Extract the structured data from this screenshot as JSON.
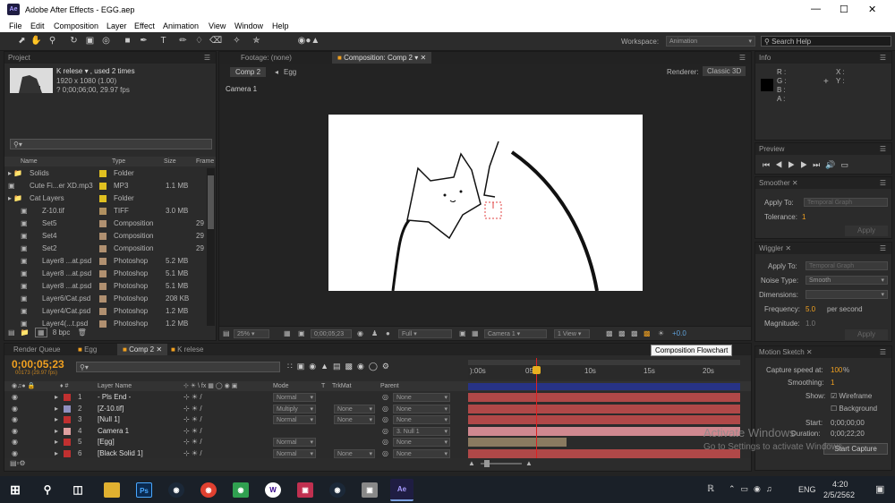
{
  "window": {
    "title": "Adobe After Effects - EGG.aep",
    "app_icon": "Ae"
  },
  "menu": [
    "File",
    "Edit",
    "Composition",
    "Layer",
    "Effect",
    "Animation",
    "View",
    "Window",
    "Help"
  ],
  "toolbar": {
    "workspace_label": "Workspace:",
    "workspace_value": "Animation",
    "search_placeholder": "Search Help"
  },
  "project": {
    "tab": "Project",
    "item_name": "K relese ▾ , used 2 times",
    "item_size": "1920 x 1080 (1.00)",
    "item_duration": "? 0;00;06;00, 29.97 fps",
    "columns": [
      "Name",
      "Type",
      "Size",
      "Frame"
    ],
    "items": [
      {
        "name": "Solids",
        "type": "Folder",
        "size": "",
        "frame": "",
        "color": "#e0c020",
        "icon": "folder-icon"
      },
      {
        "name": "Cute Fi...er XD.mp3",
        "type": "MP3",
        "size": "1.1 MB",
        "frame": "",
        "color": "#e0c020",
        "icon": "audio-icon"
      },
      {
        "name": "Cat Layers",
        "type": "Folder",
        "size": "",
        "frame": "",
        "color": "#e0c020",
        "icon": "folder-icon"
      },
      {
        "name": "Z-10.tif",
        "type": "TIFF",
        "size": "3.0 MB",
        "frame": "",
        "color": "#b09060",
        "icon": "image-icon"
      },
      {
        "name": "Set5",
        "type": "Composition",
        "size": "",
        "frame": "29",
        "color": "#b09070",
        "icon": "composition-icon"
      },
      {
        "name": "Set4",
        "type": "Composition",
        "size": "",
        "frame": "29",
        "color": "#b09070",
        "icon": "composition-icon"
      },
      {
        "name": "Set2",
        "type": "Composition",
        "size": "",
        "frame": "29",
        "color": "#b09070",
        "icon": "composition-icon"
      },
      {
        "name": "Layer8 ...at.psd",
        "type": "Photoshop",
        "size": "5.2 MB",
        "frame": "",
        "color": "#b09070",
        "icon": "psd-icon"
      },
      {
        "name": "Layer8 ...at.psd",
        "type": "Photoshop",
        "size": "5.1 MB",
        "frame": "",
        "color": "#b09070",
        "icon": "psd-icon"
      },
      {
        "name": "Layer8 ...at.psd",
        "type": "Photoshop",
        "size": "5.1 MB",
        "frame": "",
        "color": "#b09070",
        "icon": "psd-icon"
      },
      {
        "name": "Layer6/Cat.psd",
        "type": "Photoshop",
        "size": "208 KB",
        "frame": "",
        "color": "#b09070",
        "icon": "psd-icon"
      },
      {
        "name": "Layer4/Cat.psd",
        "type": "Photoshop",
        "size": "1.2 MB",
        "frame": "",
        "color": "#b09070",
        "icon": "psd-icon"
      },
      {
        "name": "Layer4(...t.psd",
        "type": "Photoshop",
        "size": "1.2 MB",
        "frame": "",
        "color": "#b09070",
        "icon": "psd-icon"
      }
    ],
    "bpc": "8 bpc"
  },
  "viewer": {
    "footage_tab": "Footage: (none)",
    "comp_tab": "Composition: Comp 2",
    "crumb1": "Comp 2",
    "crumb2": "Egg",
    "renderer_label": "Renderer:",
    "renderer_value": "Classic 3D",
    "camera_label": "Camera 1",
    "zoom": "25%",
    "timecode": "0;00;05;23",
    "quality": "Full",
    "camera": "Camera 1",
    "views": "1 View",
    "exposure": "+0.0"
  },
  "info": {
    "tab": "Info",
    "r": "R :",
    "g": "G :",
    "b": "B :",
    "a": "A :",
    "x": "X :",
    "y": "Y :"
  },
  "preview": {
    "tab": "Preview"
  },
  "smoother": {
    "tab": "Smoother",
    "apply_to_label": "Apply To:",
    "apply_to_value": "Temporal Graph",
    "tolerance_label": "Tolerance:",
    "tolerance_value": "1",
    "apply": "Apply"
  },
  "wiggler": {
    "tab": "Wiggler",
    "apply_to_label": "Apply To:",
    "apply_to_value": "Temporal Graph",
    "noise_label": "Noise Type:",
    "noise_value": "Smooth",
    "dims_label": "Dimensions:",
    "freq_label": "Frequency:",
    "freq_value": "5.0",
    "freq_unit": "per second",
    "mag_label": "Magnitude:",
    "mag_value": "1.0",
    "apply": "Apply"
  },
  "motion_sketch": {
    "tab": "Motion Sketch",
    "capture_label": "Capture speed at:",
    "capture_value": "100",
    "capture_unit": "%",
    "smoothing_label": "Smoothing:",
    "smoothing_value": "1",
    "show_label": "Show:",
    "wireframe": "Wireframe",
    "background": "Background",
    "start_label": "Start:",
    "start_value": "0;00;00;00",
    "duration_label": "Duration:",
    "duration_value": "0;00;22;20",
    "start_capture": "Start Capture"
  },
  "timeline": {
    "tabs": [
      "Render Queue",
      "Egg",
      "Comp 2",
      "K relese"
    ],
    "timecode": "0;00;05;23",
    "frames": "00173 (29.97 fps)",
    "tooltip": "Composition Flowchart",
    "col_layer": "Layer Name",
    "col_mode": "Mode",
    "col_t": "T",
    "col_trkmat": "TrkMat",
    "col_parent": "Parent",
    "ruler": [
      "):00s",
      "05s",
      "10s",
      "15s",
      "20s"
    ],
    "layers": [
      {
        "num": "1",
        "name": "- Pls End -",
        "color": "#c03030",
        "mode": "Normal",
        "trkmat": "",
        "parent": "None",
        "bar": "#b04848"
      },
      {
        "num": "2",
        "name": "[Z-10.tif]",
        "color": "#9090c0",
        "mode": "Multiply",
        "trkmat": "None",
        "parent": "None",
        "bar": "#b04848"
      },
      {
        "num": "3",
        "name": "[Null 1]",
        "color": "#c03030",
        "mode": "Normal",
        "trkmat": "None",
        "parent": "None",
        "bar": "#b04848"
      },
      {
        "num": "4",
        "name": "Camera 1",
        "color": "#e0a0a0",
        "mode": "",
        "trkmat": "",
        "parent": "3. Null 1",
        "bar": "#d08890"
      },
      {
        "num": "5",
        "name": "[Egg]",
        "color": "#c03030",
        "mode": "Normal",
        "trkmat": "",
        "parent": "None",
        "bar": "#8a7a60"
      },
      {
        "num": "6",
        "name": "[Black Solid 1]",
        "color": "#c03030",
        "mode": "Normal",
        "trkmat": "None",
        "parent": "None",
        "bar": "#b04848"
      }
    ]
  },
  "watermark": {
    "line1": "Activate Windows",
    "line2": "Go to Settings to activate Windows."
  },
  "taskbar": {
    "time": "4:20",
    "date": "2/5/2562",
    "lang": "ENG"
  }
}
